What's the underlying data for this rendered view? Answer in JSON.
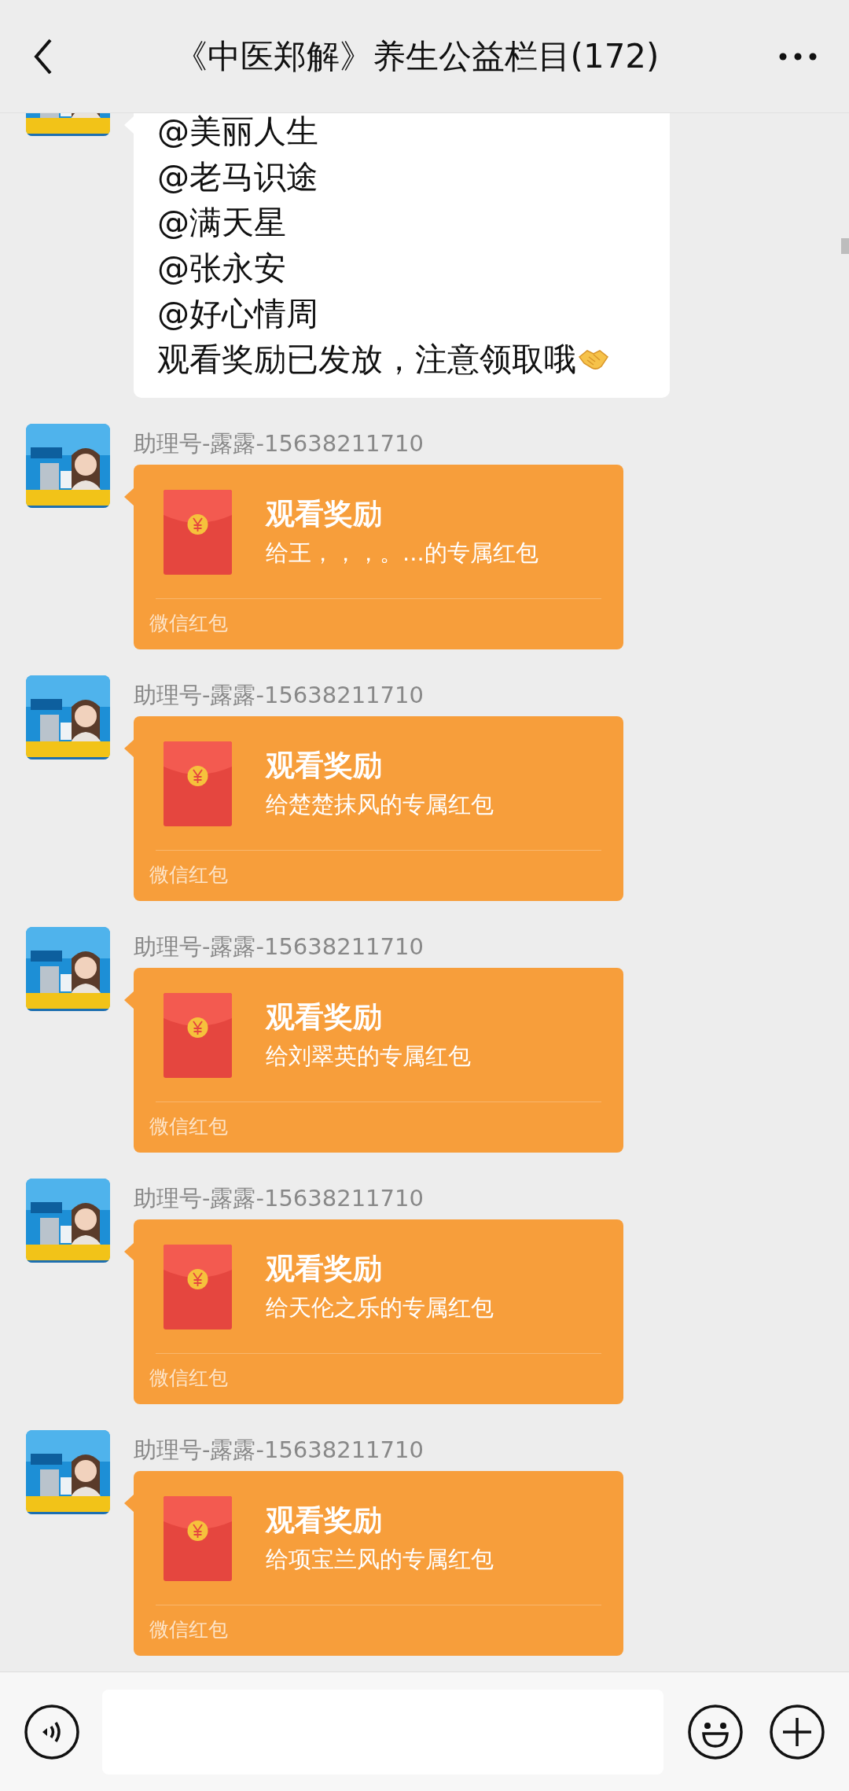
{
  "header": {
    "title": "《中医郑解》养生公益栏目(172)"
  },
  "messages": [
    {
      "kind": "text",
      "lines": [
        "@美丽人生",
        "@老马识途",
        "@满天星",
        "@张永安",
        "@好心情周",
        "观看奖励已发放，注意领取哦"
      ]
    },
    {
      "kind": "red_packet",
      "sender": "助理号-露露-15638211710",
      "title": "观看奖励",
      "subtitle": "给王，，，。...的专属红包",
      "footer": "微信红包"
    },
    {
      "kind": "red_packet",
      "sender": "助理号-露露-15638211710",
      "title": "观看奖励",
      "subtitle": "给楚楚抹风的专属红包",
      "footer": "微信红包"
    },
    {
      "kind": "red_packet",
      "sender": "助理号-露露-15638211710",
      "title": "观看奖励",
      "subtitle": "给刘翠英的专属红包",
      "footer": "微信红包"
    },
    {
      "kind": "red_packet",
      "sender": "助理号-露露-15638211710",
      "title": "观看奖励",
      "subtitle": "给天伦之乐的专属红包",
      "footer": "微信红包"
    },
    {
      "kind": "red_packet",
      "sender": "助理号-露露-15638211710",
      "title": "观看奖励",
      "subtitle": "给项宝兰风的专属红包",
      "footer": "微信红包"
    }
  ]
}
